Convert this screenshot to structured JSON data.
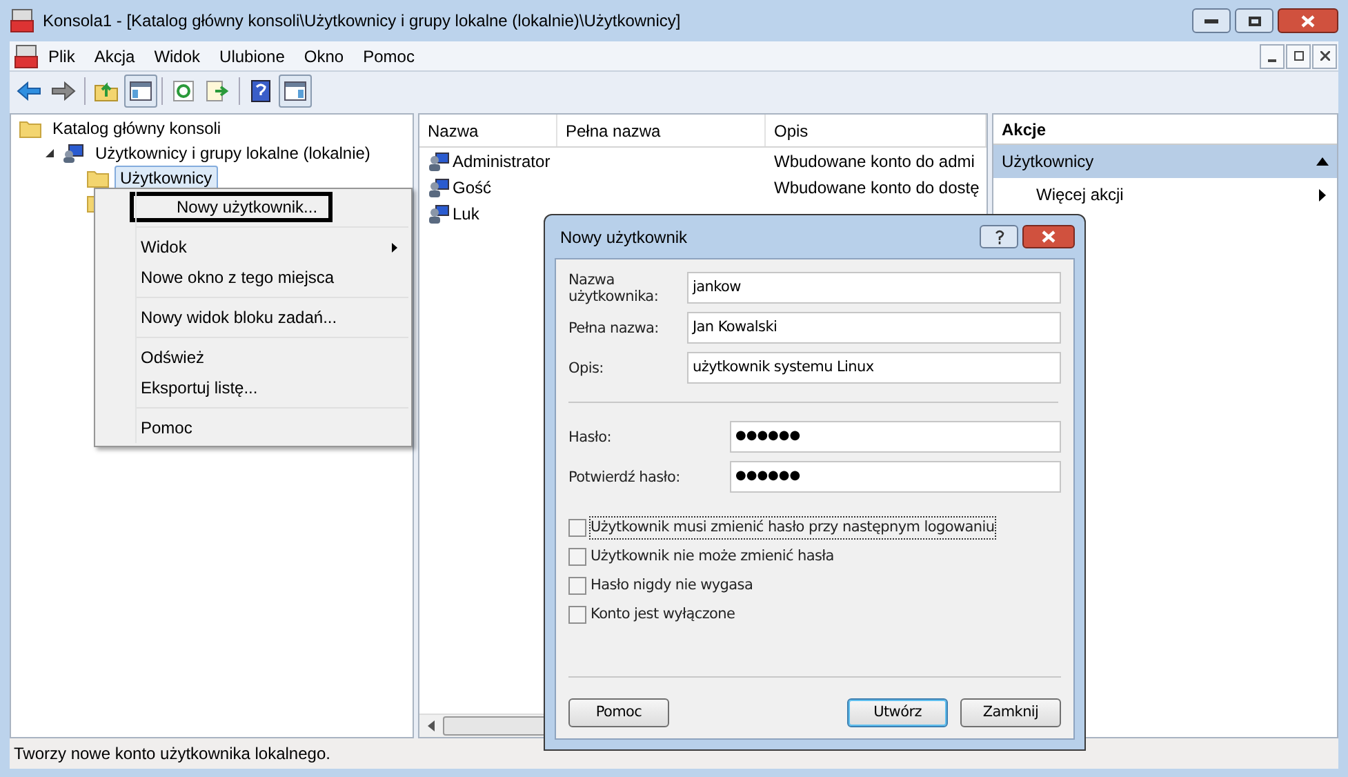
{
  "window": {
    "title": "Konsola1 - [Katalog główny konsoli\\Użytkownicy i grupy lokalne (lokalnie)\\Użytkownicy]"
  },
  "menu_bar": [
    "Plik",
    "Akcja",
    "Widok",
    "Ulubione",
    "Okno",
    "Pomoc"
  ],
  "tree": [
    {
      "kind": "folder",
      "label": "Katalog główny konsoli",
      "children": [
        {
          "kind": "computer",
          "label": "Użytkownicy i grupy lokalne (lokalnie)",
          "expanded": true,
          "children": [
            {
              "kind": "folder",
              "label": "Użytkownicy",
              "selected": true
            },
            {
              "kind": "folder"
            }
          ]
        }
      ]
    }
  ],
  "list": {
    "columns": [
      "Nazwa",
      "Pełna nazwa",
      "Opis"
    ],
    "rows": [
      {
        "name": "Administrator",
        "full_name": "",
        "description": "Wbudowane konto do admi"
      },
      {
        "name": "Gość",
        "full_name": "",
        "description": "Wbudowane konto do dostę"
      },
      {
        "name": "Luk",
        "full_name": "",
        "description": ""
      }
    ]
  },
  "actions": {
    "title": "Akcje",
    "section": "Użytkownicy",
    "items": [
      "Więcej akcji"
    ]
  },
  "context_menu": [
    {
      "kind": "item",
      "label": "Nowy użytkownik...",
      "selected": true,
      "submenu": false
    },
    {
      "kind": "separator"
    },
    {
      "kind": "item",
      "label": "Widok",
      "selected": false,
      "submenu": true
    },
    {
      "kind": "item",
      "label": "Nowe okno z tego miejsca",
      "selected": false,
      "submenu": false
    },
    {
      "kind": "separator"
    },
    {
      "kind": "item",
      "label": "Nowy widok bloku zadań...",
      "selected": false,
      "submenu": false
    },
    {
      "kind": "separator"
    },
    {
      "kind": "item",
      "label": "Odśwież",
      "selected": false,
      "submenu": false
    },
    {
      "kind": "item",
      "label": "Eksportuj listę...",
      "selected": false,
      "submenu": false
    },
    {
      "kind": "separator"
    },
    {
      "kind": "item",
      "label": "Pomoc",
      "selected": false,
      "submenu": false
    }
  ],
  "dialog": {
    "title": "Nowy użytkownik",
    "fields": [
      {
        "label": "Nazwa użytkownika:",
        "value": "jankow",
        "kind": "text"
      },
      {
        "label": "Pełna nazwa:",
        "value": "Jan Kowalski",
        "kind": "text"
      },
      {
        "label": "Opis:",
        "value": "użytkownik systemu Linux",
        "kind": "text"
      },
      {
        "label": "Hasło:",
        "value": "●●●●●●",
        "kind": "password"
      },
      {
        "label": "Potwierdź hasło:",
        "value": "●●●●●●",
        "kind": "password"
      }
    ],
    "checkboxes": [
      {
        "label": "Użytkownik musi zmienić hasło przy następnym logowaniu",
        "checked": false,
        "focused": true
      },
      {
        "label": "Użytkownik nie może zmienić hasła",
        "checked": false,
        "focused": false
      },
      {
        "label": "Hasło nigdy nie wygasa",
        "checked": false,
        "focused": false
      },
      {
        "label": "Konto jest wyłączone",
        "checked": false,
        "focused": false
      }
    ],
    "buttons": [
      {
        "label": "Pomoc",
        "default": false
      },
      {
        "label": "Utwórz",
        "default": true
      },
      {
        "label": "Zamknij",
        "default": false
      }
    ]
  },
  "status_bar": "Tworzy nowe konto użytkownika lokalnego."
}
